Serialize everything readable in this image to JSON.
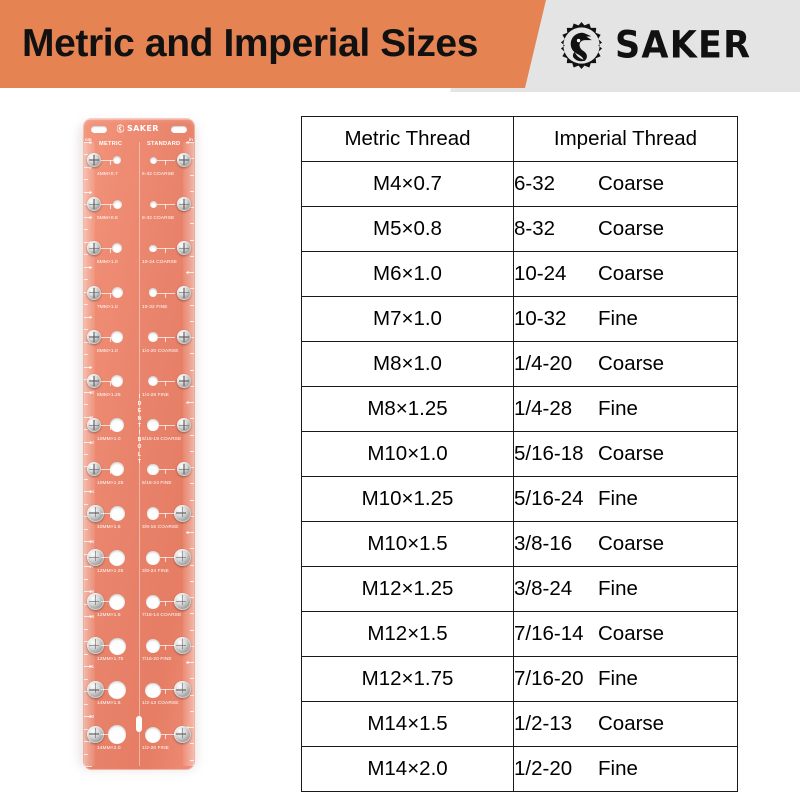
{
  "header": {
    "title": "Metric and Imperial Sizes",
    "brand": "SAKER",
    "logo_icon": "falcon-head-in-gear-icon",
    "orange": "#e58352",
    "gray": "#e4e4e4",
    "text_color": "#111111"
  },
  "gauge": {
    "brand": "SAKER",
    "brand_icon": "falcon-head-in-gear-icon",
    "left_column_header": "METRIC",
    "right_column_header": "STANDARD",
    "left_ruler_unit": "cm",
    "right_ruler_unit": "in",
    "center_text": "IDENTIBOLT",
    "body_color": "#e8826a",
    "cm_numbers": [
      "0",
      "1",
      "2",
      "3",
      "4",
      "5",
      "6",
      "7",
      "8",
      "9",
      "10",
      "11",
      "12",
      "13",
      "14",
      "15",
      "16",
      "17",
      "18",
      "19",
      "20",
      "21",
      "22",
      "23",
      "24"
    ],
    "in_numbers": [
      "0",
      "1",
      "2",
      "3",
      "4",
      "5",
      "6",
      "7",
      "8",
      "9"
    ],
    "metric_labels": [
      "4MM×0.7",
      "5MM×0.8",
      "6MM×1.0",
      "7MM×1.0",
      "8MM×1.0",
      "8MM×1.25",
      "10MM×1.0",
      "10MM×1.25",
      "10MM×1.5",
      "12MM×1.25",
      "12MM×1.5",
      "12MM×1.75",
      "14MM×1.5",
      "14MM×2.0"
    ],
    "standard_labels": [
      "6-32 COARSE",
      "8-32 COARSE",
      "10-24 COARSE",
      "10-32 FINE",
      "1/4-20 COARSE",
      "1/4-28 FINE",
      "5/16-18 COARSE",
      "5/16-24 FINE",
      "3/8-16 COARSE",
      "3/8-24 FINE",
      "7/16-14 COARSE",
      "7/16-20 FINE",
      "1/2-13 COARSE",
      "1/2-20 FINE"
    ]
  },
  "table": {
    "headers": [
      "Metric Thread",
      "Imperial Thread"
    ],
    "rows": [
      {
        "metric": "M4×0.7",
        "imperial_size": "6-32",
        "imperial_type": "Coarse"
      },
      {
        "metric": "M5×0.8",
        "imperial_size": "8-32",
        "imperial_type": "Coarse"
      },
      {
        "metric": "M6×1.0",
        "imperial_size": "10-24",
        "imperial_type": "Coarse"
      },
      {
        "metric": "M7×1.0",
        "imperial_size": "10-32",
        "imperial_type": "Fine"
      },
      {
        "metric": "M8×1.0",
        "imperial_size": "1/4-20",
        "imperial_type": "Coarse"
      },
      {
        "metric": "M8×1.25",
        "imperial_size": "1/4-28",
        "imperial_type": "Fine"
      },
      {
        "metric": "M10×1.0",
        "imperial_size": "5/16-18",
        "imperial_type": "Coarse"
      },
      {
        "metric": "M10×1.25",
        "imperial_size": "5/16-24",
        "imperial_type": "Fine"
      },
      {
        "metric": "M10×1.5",
        "imperial_size": "3/8-16",
        "imperial_type": "Coarse"
      },
      {
        "metric": "M12×1.25",
        "imperial_size": "3/8-24",
        "imperial_type": "Fine"
      },
      {
        "metric": "M12×1.5",
        "imperial_size": "7/16-14",
        "imperial_type": "Coarse"
      },
      {
        "metric": "M12×1.75",
        "imperial_size": "7/16-20",
        "imperial_type": "Fine"
      },
      {
        "metric": "M14×1.5",
        "imperial_size": "1/2-13",
        "imperial_type": "Coarse"
      },
      {
        "metric": "M14×2.0",
        "imperial_size": "1/2-20",
        "imperial_type": "Fine"
      }
    ]
  }
}
